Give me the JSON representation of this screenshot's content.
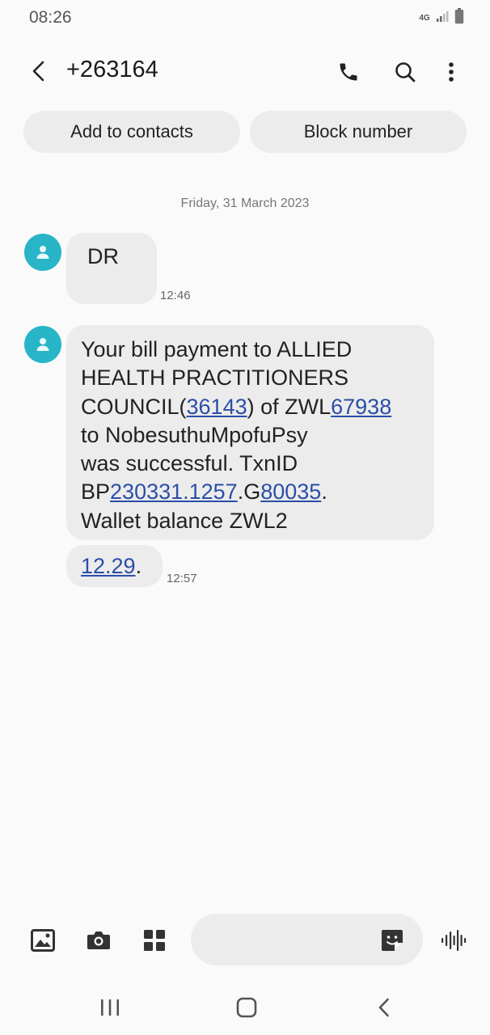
{
  "status_bar": {
    "time": "08:26",
    "network": "4G"
  },
  "header": {
    "title": "+263164",
    "back_icon": "chevron-left-icon",
    "call_icon": "phone-icon",
    "search_icon": "search-icon",
    "more_icon": "more-vertical-icon"
  },
  "actions": {
    "add_to_contacts": "Add to contacts",
    "block_number": "Block number"
  },
  "conversation": {
    "date": "Friday, 31 March 2023",
    "messages": [
      {
        "text": "DR",
        "time": "12:46"
      },
      {
        "time": "12:57",
        "segments": {
          "s1": "Your bill payment to ALLIED",
          "s2": "HEALTH PRACTITIONERS",
          "s3": "COUNCIL(",
          "link1": "36143",
          "s4": ") of ZWL",
          "link2": "67938",
          "s5": "to NobesuthuMpofuPsy",
          "s6": "was successful. TxnID",
          "s7": "BP",
          "link3": "230331.1257",
          "s8": ".G",
          "link4": "80035",
          "s9": ".",
          "s10": "Wallet balance ZWL2",
          "link5": "12.29",
          "s11": "."
        }
      }
    ]
  },
  "composer": {
    "placeholder": "",
    "icons": [
      "gallery-icon",
      "camera-icon",
      "apps-icon",
      "sticker-icon",
      "voice-icon"
    ]
  },
  "colors": {
    "avatar": "#27b5c7",
    "bubble": "#ececec",
    "link": "#2a4ea8",
    "background": "#fafafa"
  }
}
